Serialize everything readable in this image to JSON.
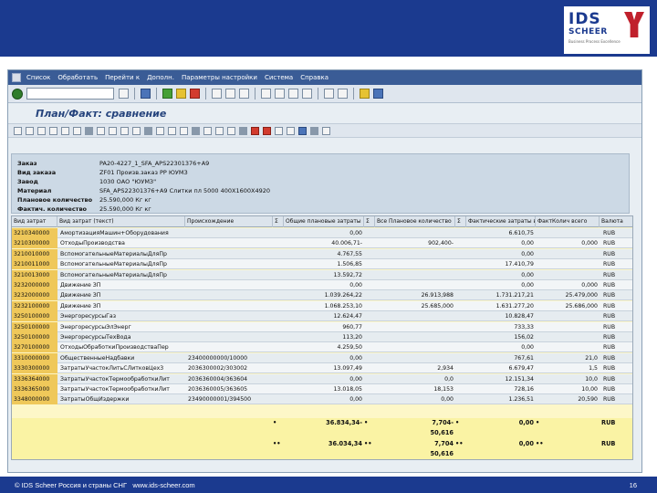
{
  "logo": {
    "line1": "IDS",
    "line2": "SCHEER",
    "tagline": "Business Process Excellence"
  },
  "menubar": [
    "Список",
    "Обработать",
    "Перейти к",
    "Дополн.",
    "Параметры настройки",
    "Система",
    "Справка"
  ],
  "title": "План/Факт: сравнение",
  "header": [
    {
      "label": "Заказ",
      "value": "PA20-4227_1_SFA_APS22301376+A9"
    },
    {
      "label": "Вид заказа",
      "value": "ZF01 Произв.заказ РР ЮУМЗ"
    },
    {
      "label": "Завод",
      "value": "1030 ОАО \"ЮУМЗ\""
    },
    {
      "label": "Материал",
      "value": "SFA_APS22301376+A9 Слитки пл 5000 400X1600X4920"
    },
    {
      "label": "Плановое количество",
      "value": "25.590,000 Кг кг"
    },
    {
      "label": "Фактич. количество",
      "value": "25.590,000 Кг кг"
    }
  ],
  "grid": {
    "columns": [
      "Вид затрат",
      "Вид затрат (текст)",
      "Происхождение",
      "Σ",
      "Общие плановые затраты",
      "Σ",
      "Все Плановое количество",
      "Σ",
      "Фактические затраты всего",
      "ФактКолич всего",
      "Валюта"
    ],
    "rows": [
      [
        "3210340000",
        "АмортизацияМашин+Оборудования",
        "",
        "0,00",
        "",
        "6.610,75",
        "",
        "RUB"
      ],
      [
        "3210300000",
        "ОтходыПроизводства",
        "",
        "40.006,71-",
        "902,400-",
        "0,00",
        "0,000",
        "RUB"
      ],
      [
        "3210010000",
        "ВспомогательныеМатериалыДляПр",
        "",
        "4.767,55",
        "",
        "0,00",
        "",
        "RUB"
      ],
      [
        "3210011000",
        "ВспомогательныеМатериалыДляПр",
        "",
        "1.506,85",
        "",
        "17.410,79",
        "",
        "RUB"
      ],
      [
        "3210013000",
        "ВспомогательныеМатериалыДляПр",
        "",
        "13.592,72",
        "",
        "0,00",
        "",
        "RUB"
      ],
      [
        "3232000000",
        "Движение ЗП",
        "",
        "0,00",
        "",
        "0,00",
        "0,000",
        "RUB"
      ],
      [
        "3232000000",
        "Движение ЗП",
        "",
        "1.039.264,22",
        "26.913,988",
        "1.731.217,21",
        "25.479,000",
        "RUB"
      ],
      [
        "3232100000",
        "Движение ЗП",
        "",
        "1.068.253,10",
        "25.685,000",
        "1.631.277,20",
        "25.686,000",
        "RUB"
      ],
      [
        "3250100000",
        "ЭнергоресурсыГаз",
        "",
        "12.624,47",
        "",
        "10.828,47",
        "",
        "RUB"
      ],
      [
        "3250100000",
        "ЭнергоресурсыЭлЭнерг",
        "",
        "960,77",
        "",
        "733,33",
        "",
        "RUB"
      ],
      [
        "3250100000",
        "ЭнергоресурсыТехВода",
        "",
        "113,20",
        "",
        "156,02",
        "",
        "RUB"
      ],
      [
        "3270100000",
        "ОтходыОбработкиПроизводстваПер",
        "",
        "4.259,50",
        "",
        "0,00",
        "",
        "RUB"
      ],
      [
        "3310000000",
        "ОбщественныеНадбавки",
        "23400000000/10000",
        "0,00",
        "",
        "767,61",
        "21,0",
        "RUB"
      ],
      [
        "3330300000",
        "ЗатратыУчастокЛитьСЛитковЦех3",
        "2036300002/303002",
        "13.097,49",
        "2,934",
        "6.679,47",
        "1,5",
        "RUB"
      ],
      [
        "3336364000",
        "ЗатратыУчастокТермообработкиЛит",
        "2036360004/363604",
        "0,00",
        "0,0",
        "12.151,34",
        "10,0",
        "RUB"
      ],
      [
        "3336365000",
        "ЗатратыУчастокТермообработкиЛит",
        "2036360005/363605",
        "13.018,05",
        "18,153",
        "728,16",
        "10,00",
        "RUB"
      ],
      [
        "3348000000",
        "ЗатратыОбщИздержки",
        "23490000001/394500",
        "0,00",
        "0,00",
        "1.236,51",
        "20,590",
        "RUB"
      ]
    ],
    "subtotal": {
      "mark": "•",
      "plan": "36.834,34-",
      "qty": "7,704-",
      "qty2": "50,616",
      "actual": "0,00",
      "currency": "RUB"
    },
    "total": {
      "mark": "••",
      "plan": "36.034,34",
      "qty": "7,704",
      "qty2": "50,616",
      "actual": "0,00",
      "currency": "RUB"
    }
  },
  "footer": {
    "copyright": "© IDS Scheer Россия и страны СНГ",
    "url": "www.ids-scheer.com",
    "page": "16"
  }
}
